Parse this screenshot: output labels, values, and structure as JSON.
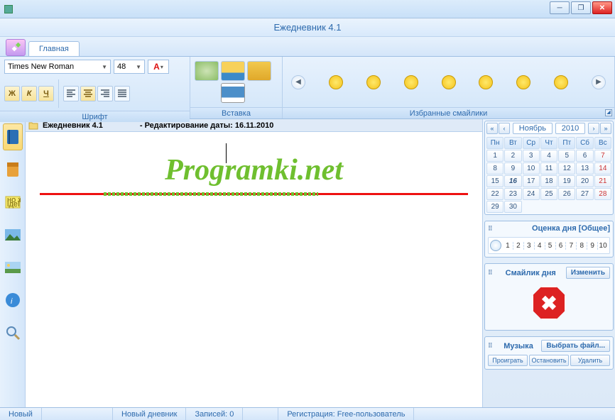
{
  "window": {
    "title": "Ежедневник 4.1"
  },
  "tabs": {
    "main": "Главная"
  },
  "font_group": {
    "label": "Шрифт",
    "font": "Times New Roman",
    "size": "48",
    "bold": "Ж",
    "italic": "К",
    "underline": "Ч"
  },
  "insert_group": {
    "label": "Вставка"
  },
  "smileys_group": {
    "label": "Избранные смайлики"
  },
  "editor": {
    "doc_title": "Ежедневник 4.1",
    "edit_label": "- Редактирование даты: 16.11.2010",
    "watermark": "Programki.net"
  },
  "calendar": {
    "month": "Ноябрь",
    "year": "2010",
    "dow": [
      "Пн",
      "Вт",
      "Ср",
      "Чт",
      "Пт",
      "Сб",
      "Вс"
    ],
    "weeks": [
      [
        1,
        2,
        3,
        4,
        5,
        6,
        7
      ],
      [
        8,
        9,
        10,
        11,
        12,
        13,
        14
      ],
      [
        15,
        16,
        17,
        18,
        19,
        20,
        21
      ],
      [
        22,
        23,
        24,
        25,
        26,
        27,
        28
      ],
      [
        29,
        30,
        null,
        null,
        null,
        null,
        null
      ]
    ],
    "today": 16
  },
  "rating": {
    "title": "Оценка дня [Общее]",
    "values": [
      "1",
      "2",
      "3",
      "4",
      "5",
      "6",
      "7",
      "8",
      "9",
      "10"
    ]
  },
  "day_smiley": {
    "title": "Смайлик дня",
    "change": "Изменить"
  },
  "music": {
    "title": "Музыка",
    "choose": "Выбрать файл...",
    "play": "Проиграть",
    "stop": "Остановить",
    "delete": "Удалить"
  },
  "status": {
    "mode": "Новый",
    "diary": "Новый дневник",
    "records": "Записей: 0",
    "reg": "Регистрация: Free-пользователь"
  }
}
